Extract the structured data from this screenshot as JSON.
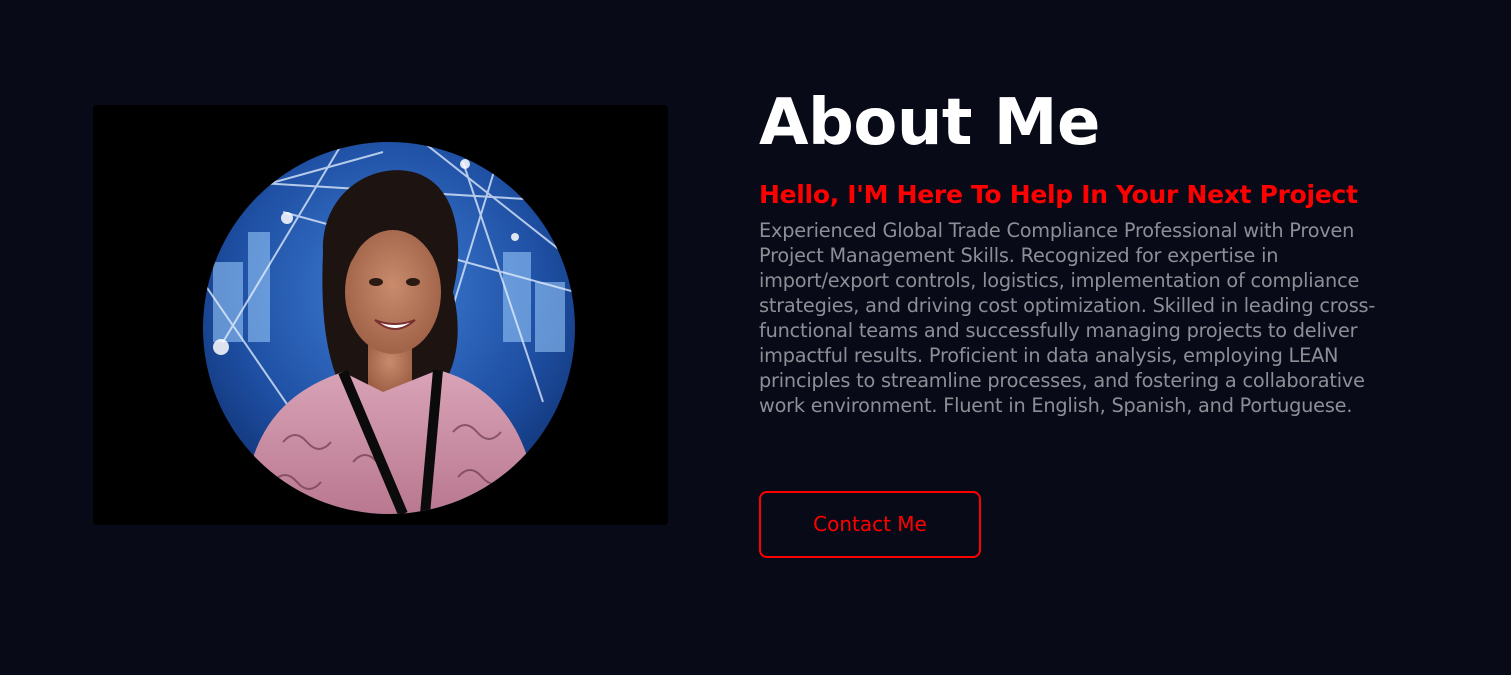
{
  "colors": {
    "background": "#080a17",
    "photo_frame": "#000000",
    "accent": "#ff0000",
    "heading": "#ffffff",
    "body_text": "#8d8f97"
  },
  "about": {
    "title": "About Me",
    "subtitle": "Hello, I'M Here To Help In Your Next Project",
    "bio": "Experienced Global Trade Compliance Professional with Proven Project Management Skills. Recognized for expertise in import/export controls, logistics, implementation of compliance strategies, and driving cost optimization. Skilled in leading cross-functional teams and successfully managing projects to deliver impactful results. Proficient in data analysis, employing LEAN principles to streamline processes, and fostering a collaborative work environment. Fluent in English, Spanish, and Portuguese.",
    "contact_label": "Contact Me"
  }
}
